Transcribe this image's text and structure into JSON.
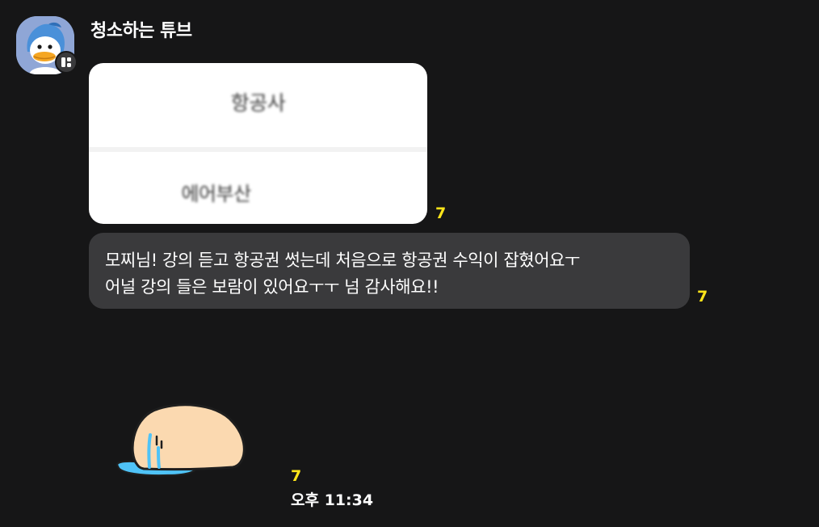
{
  "sender": {
    "name": "청소하는 튜브",
    "avatar_icon": "tube-duck-avatar-icon"
  },
  "messages": {
    "image_card": {
      "header_label": "항공사",
      "value_label": "에어부산",
      "unread_count": "7"
    },
    "text_message": {
      "lines": [
        "모찌님! 강의 듣고 항공권 썻는데 처음으로 항공권 수익이 잡혔어요ㅜ",
        "어널 강의 들은 보람이 있어요ㅜㅜ 넘 감사해요!!"
      ],
      "unread_count": "7"
    },
    "sticker": {
      "icon": "crying-blob-sticker-icon",
      "unread_count": "7",
      "time": "오후 11:34"
    }
  },
  "colors": {
    "background": "#161617",
    "bubble": "#3a3a3c",
    "unread_count": "#ffe51a",
    "card": "#ffffff"
  }
}
